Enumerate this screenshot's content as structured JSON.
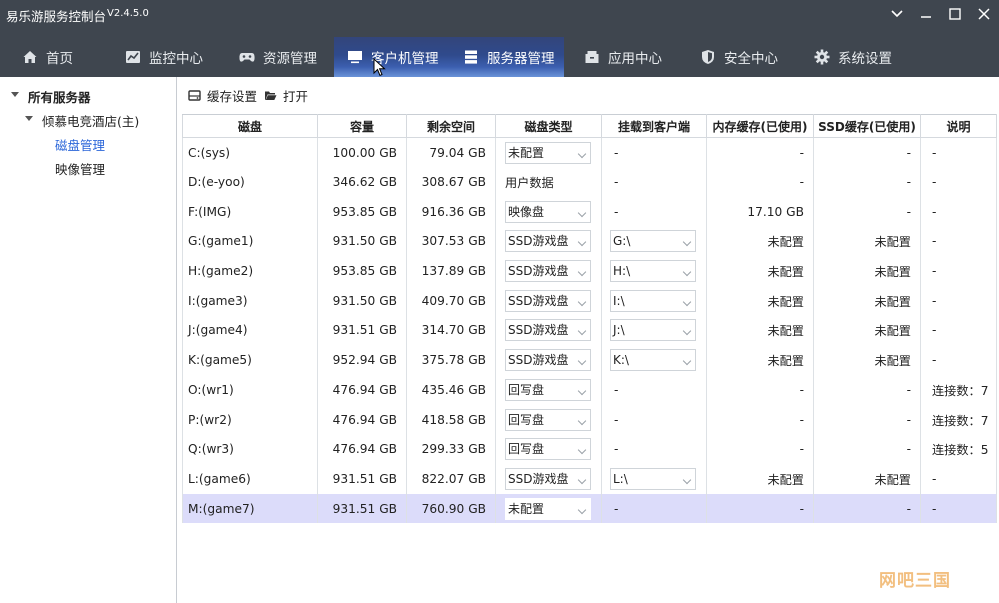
{
  "app": {
    "title": "易乐游服务控制台",
    "version": "V2.4.5.0"
  },
  "nav": {
    "home": "首页",
    "monitor": "监控中心",
    "resources": "资源管理",
    "client": "客户机管理",
    "server": "服务器管理",
    "apps": "应用中心",
    "security": "安全中心",
    "settings": "系统设置"
  },
  "tree": {
    "root": "所有服务器",
    "server": "倾慕电竞酒店(主)",
    "disk_mgmt": "磁盘管理",
    "image_mgmt": "映像管理"
  },
  "toolbar": {
    "cache_settings": "缓存设置",
    "open": "打开"
  },
  "table": {
    "headers": [
      "磁盘",
      "容量",
      "剩余空间",
      "磁盘类型",
      "挂载到客户端",
      "内存缓存(已使用)",
      "SSD缓存(已使用)",
      "说明"
    ],
    "rows": [
      {
        "disk": "C:(sys)",
        "capacity": "100.00 GB",
        "free": "79.04 GB",
        "type": "未配置",
        "type_dd": true,
        "mount": "-",
        "mount_dd": false,
        "mem": "-",
        "ssd": "-",
        "note": "-"
      },
      {
        "disk": "D:(e-yoo)",
        "capacity": "346.62 GB",
        "free": "308.67 GB",
        "type": "用户数据",
        "type_dd": false,
        "mount": "-",
        "mount_dd": false,
        "mem": "-",
        "ssd": "-",
        "note": "-"
      },
      {
        "disk": "F:(IMG)",
        "capacity": "953.85 GB",
        "free": "916.36 GB",
        "type": "映像盘",
        "type_dd": true,
        "mount": "-",
        "mount_dd": false,
        "mem": "17.10 GB",
        "ssd": "-",
        "note": "-"
      },
      {
        "disk": "G:(game1)",
        "capacity": "931.50 GB",
        "free": "307.53 GB",
        "type": "SSD游戏盘",
        "type_dd": true,
        "mount": "G:\\",
        "mount_dd": true,
        "mem": "未配置",
        "ssd": "未配置",
        "note": "-"
      },
      {
        "disk": "H:(game2)",
        "capacity": "953.85 GB",
        "free": "137.89 GB",
        "type": "SSD游戏盘",
        "type_dd": true,
        "mount": "H:\\",
        "mount_dd": true,
        "mem": "未配置",
        "ssd": "未配置",
        "note": "-"
      },
      {
        "disk": "I:(game3)",
        "capacity": "931.50 GB",
        "free": "409.70 GB",
        "type": "SSD游戏盘",
        "type_dd": true,
        "mount": "I:\\",
        "mount_dd": true,
        "mem": "未配置",
        "ssd": "未配置",
        "note": "-"
      },
      {
        "disk": "J:(game4)",
        "capacity": "931.51 GB",
        "free": "314.70 GB",
        "type": "SSD游戏盘",
        "type_dd": true,
        "mount": "J:\\",
        "mount_dd": true,
        "mem": "未配置",
        "ssd": "未配置",
        "note": "-"
      },
      {
        "disk": "K:(game5)",
        "capacity": "952.94 GB",
        "free": "375.78 GB",
        "type": "SSD游戏盘",
        "type_dd": true,
        "mount": "K:\\",
        "mount_dd": true,
        "mem": "未配置",
        "ssd": "未配置",
        "note": "-"
      },
      {
        "disk": "O:(wr1)",
        "capacity": "476.94 GB",
        "free": "435.46 GB",
        "type": "回写盘",
        "type_dd": true,
        "mount": "-",
        "mount_dd": false,
        "mem": "-",
        "ssd": "-",
        "note": "连接数：7"
      },
      {
        "disk": "P:(wr2)",
        "capacity": "476.94 GB",
        "free": "418.58 GB",
        "type": "回写盘",
        "type_dd": true,
        "mount": "-",
        "mount_dd": false,
        "mem": "-",
        "ssd": "-",
        "note": "连接数：7"
      },
      {
        "disk": "Q:(wr3)",
        "capacity": "476.94 GB",
        "free": "299.33 GB",
        "type": "回写盘",
        "type_dd": true,
        "mount": "-",
        "mount_dd": false,
        "mem": "-",
        "ssd": "-",
        "note": "连接数：5"
      },
      {
        "disk": "L:(game6)",
        "capacity": "931.51 GB",
        "free": "822.07 GB",
        "type": "SSD游戏盘",
        "type_dd": true,
        "mount": "L:\\",
        "mount_dd": true,
        "mem": "未配置",
        "ssd": "未配置",
        "note": "-"
      },
      {
        "disk": "M:(game7)",
        "capacity": "931.51 GB",
        "free": "760.90 GB",
        "type": "未配置",
        "type_dd": true,
        "mount": "-",
        "mount_dd": false,
        "mem": "-",
        "ssd": "-",
        "note": "-",
        "selected": true
      }
    ]
  },
  "watermark": "网吧三国",
  "colors": {
    "chrome": "#3f464f",
    "active_tab": "#2f4a8c",
    "selected_row": "#dcdcfa",
    "tree_selected": "#2b66d9"
  }
}
